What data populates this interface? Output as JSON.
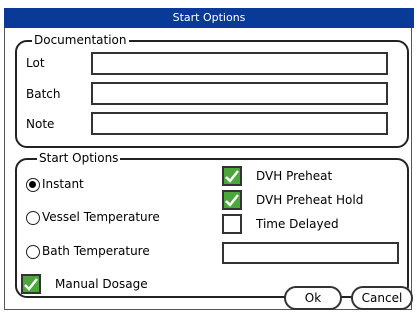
{
  "window": {
    "title": "Start Options"
  },
  "documentation": {
    "legend": "Documentation",
    "lot_label": "Lot",
    "batch_label": "Batch",
    "note_label": "Note",
    "lot_value": "",
    "batch_value": "",
    "note_value": ""
  },
  "start_options": {
    "legend": "Start Options",
    "radios": [
      {
        "label": "Instant",
        "checked": true
      },
      {
        "label": "Vessel Temperature",
        "checked": false
      },
      {
        "label": "Bath Temperature",
        "checked": false
      }
    ],
    "checkboxes": [
      {
        "label": "DVH Preheat",
        "checked": true
      },
      {
        "label": "DVH Preheat Hold",
        "checked": true
      },
      {
        "label": "Time Delayed",
        "checked": false
      }
    ],
    "delay_value": "",
    "manual_dosage": {
      "label": "Manual Dosage",
      "checked": true
    }
  },
  "buttons": {
    "ok": "Ok",
    "cancel": "Cancel"
  },
  "colors": {
    "titlebar": "#0a3a97",
    "check_fill": "#4aa83a"
  }
}
